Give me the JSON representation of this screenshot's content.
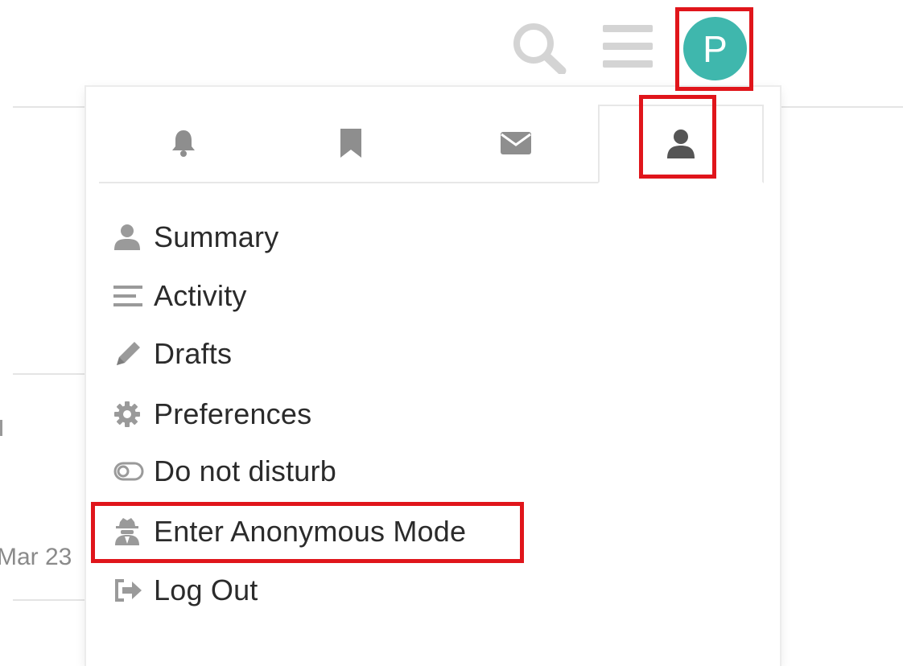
{
  "header": {
    "avatar_letter": "P",
    "avatar_color": "#3fb7ad",
    "icons": [
      "search-icon",
      "hamburger-menu-icon"
    ]
  },
  "background": {
    "date_text": "Mar 23"
  },
  "user_menu": {
    "tabs": [
      {
        "icon": "bell-icon",
        "active": false
      },
      {
        "icon": "bookmark-icon",
        "active": false
      },
      {
        "icon": "envelope-icon",
        "active": false
      },
      {
        "icon": "user-icon",
        "active": true
      }
    ],
    "items": [
      {
        "label": "Summary",
        "icon": "user-icon"
      },
      {
        "label": "Activity",
        "icon": "list-icon"
      },
      {
        "label": "Drafts",
        "icon": "pencil-icon"
      },
      {
        "label": "Preferences",
        "icon": "gear-icon"
      },
      {
        "label": "Do not disturb",
        "icon": "toggle-off-icon"
      },
      {
        "label": "Enter Anonymous Mode",
        "icon": "user-secret-icon"
      },
      {
        "label": "Log Out",
        "icon": "sign-out-icon"
      }
    ]
  },
  "highlight_color": "#e0151b"
}
